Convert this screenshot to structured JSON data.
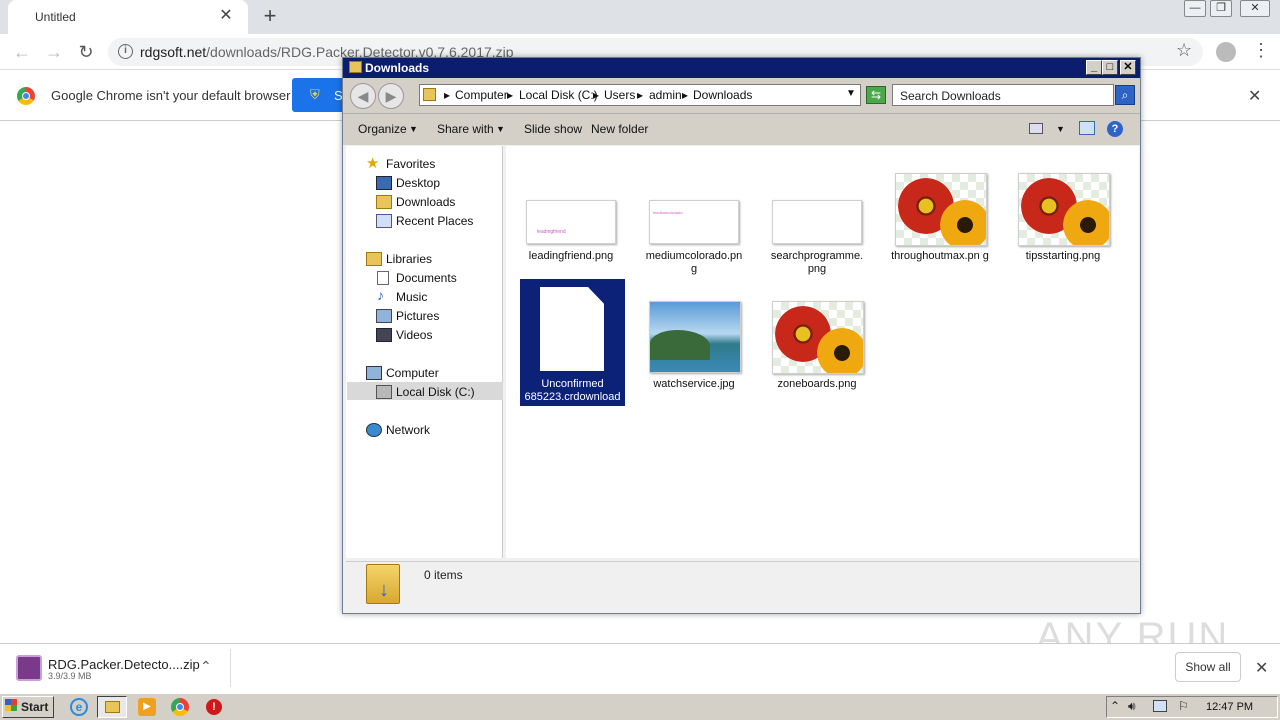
{
  "browser": {
    "tab_title": "Untitled",
    "new_tab_icon": "plus-icon",
    "url_domain": "rdgsoft.net",
    "url_path": "/downloads/RDG.Packer.Detector.v0.7.6.2017.zip",
    "infobar_text": "Google Chrome isn't your default browser",
    "infobar_button": "S"
  },
  "explorer": {
    "title": "Downloads",
    "breadcrumbs": [
      "Computer",
      "Local Disk (C:)",
      "Users",
      "admin",
      "Downloads"
    ],
    "search_placeholder": "Search Downloads",
    "commands": {
      "organize": "Organize",
      "share_with": "Share with",
      "slide_show": "Slide show",
      "new_folder": "New folder"
    },
    "nav": {
      "favorites": "Favorites",
      "desktop": "Desktop",
      "downloads": "Downloads",
      "recent": "Recent Places",
      "libraries": "Libraries",
      "documents": "Documents",
      "music": "Music",
      "pictures": "Pictures",
      "videos": "Videos",
      "computer": "Computer",
      "local_disk": "Local Disk (C:)",
      "network": "Network"
    },
    "files": [
      {
        "name": "leadingfriend.png",
        "thumb_text": "leadingfriend"
      },
      {
        "name": "mediumcolorado.pn g",
        "thumb_text": "mediumcolorado"
      },
      {
        "name": "searchprogramme. png",
        "thumb_text": ""
      },
      {
        "name": "throughoutmax.pn g"
      },
      {
        "name": "tipsstarting.png"
      },
      {
        "name": "Unconfirmed 685223.crdownload"
      },
      {
        "name": "watchservice.jpg"
      },
      {
        "name": "zoneboards.png"
      }
    ],
    "status": "0 items"
  },
  "shelf": {
    "file_name": "RDG.Packer.Detecto....zip",
    "file_size": "3.9/3.9 MB",
    "show_all": "Show all"
  },
  "taskbar": {
    "start": "Start",
    "clock": "12:47 PM"
  },
  "watermark": "ANY RUN"
}
